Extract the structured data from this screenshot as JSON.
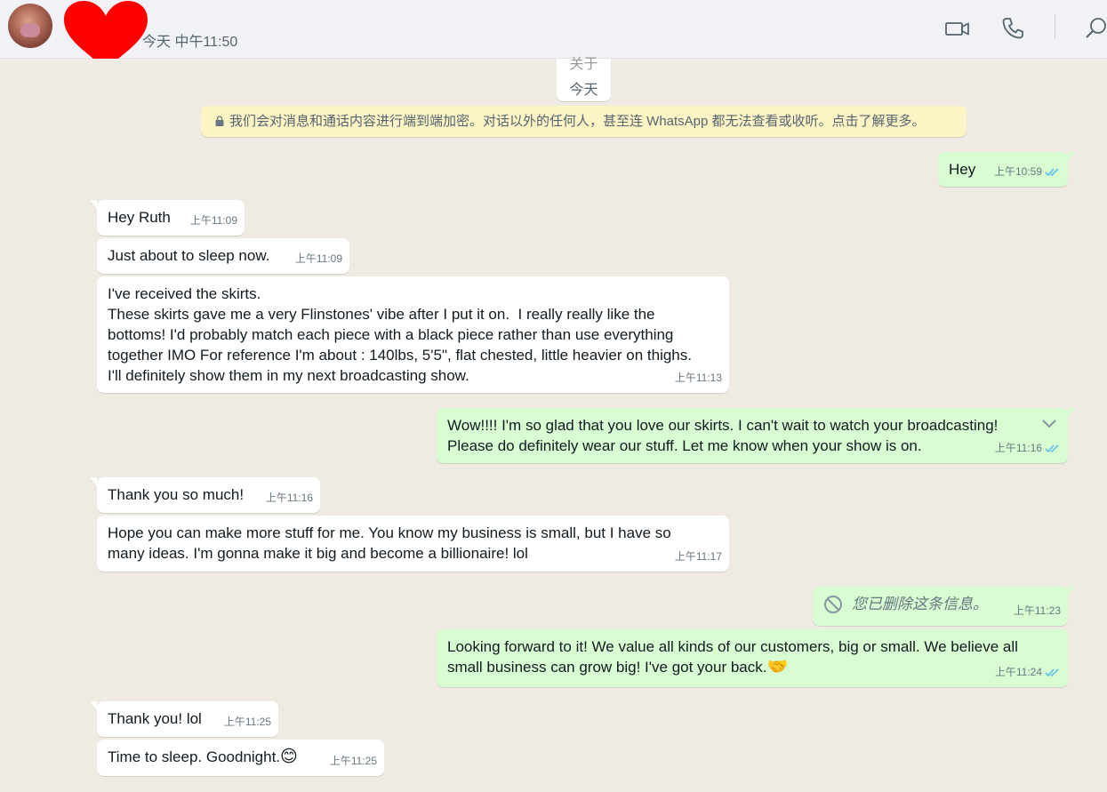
{
  "header": {
    "time_label": "今天 中午11:50",
    "icons": [
      "avatar",
      "heart-sticker",
      "video-call-icon",
      "voice-call-icon",
      "search-icon"
    ]
  },
  "chat": {
    "day_chip": {
      "ghost": "关于",
      "label": "今天"
    },
    "encryption_notice": "我们会对消息和通话内容进行端到端加密。对话以外的任何人，甚至连 WhatsApp 都无法查看或收听。点击了解更多。",
    "messages": [
      {
        "dir": "out",
        "text": "Hey",
        "time": "上午10:59"
      },
      {
        "dir": "in",
        "text": "Hey Ruth",
        "time": "上午11:09"
      },
      {
        "dir": "in",
        "text": "Just about to sleep now.",
        "time": "上午11:09"
      },
      {
        "dir": "in",
        "text": "I've received the skirts.\nThese skirts gave me a very Flinstones' vibe after I put it on.  I really really like the\nbottoms! I'd probably match each piece with a black piece rather than use everything\ntogether IMO For reference I'm about : 140lbs, 5'5\", flat chested, little heavier on thighs.\nI'll definitely show them in my next broadcasting show.",
        "time": "上午11:13"
      },
      {
        "dir": "out",
        "text": "Wow!!!! I'm so glad that you love our skirts. I can't wait to watch your broadcasting!\nPlease do definitely wear our stuff. Let me know when your show is on.",
        "time": "上午11:16"
      },
      {
        "dir": "in",
        "text": "Thank you so much!",
        "time": "上午11:16"
      },
      {
        "dir": "in",
        "text": "Hope you can make more stuff for me. You know my business is small, but I have so\nmany ideas. I'm gonna make it big and become a billionaire! lol",
        "time": "上午11:17"
      },
      {
        "dir": "out",
        "text": "您已删除这条信息。",
        "time": "上午11:23"
      },
      {
        "dir": "out",
        "text": "Looking forward to it! We value all kinds of our customers, big or small. We believe all\nsmall business can grow big! I've got your back.",
        "emoji": "🤝",
        "time": "上午11:24"
      },
      {
        "dir": "in",
        "text": "Thank you! lol",
        "time": "上午11:25"
      },
      {
        "dir": "in",
        "text": "Time to sleep. Goodnight.",
        "emoji": "😊",
        "time": "上午11:25"
      }
    ]
  },
  "colors": {
    "incoming_bubble": "#ffffff",
    "outgoing_bubble": "#d9fdd3",
    "read_tick": "#53bdeb",
    "chat_background": "#efeae2",
    "notice_background": "#fdf4c5"
  }
}
